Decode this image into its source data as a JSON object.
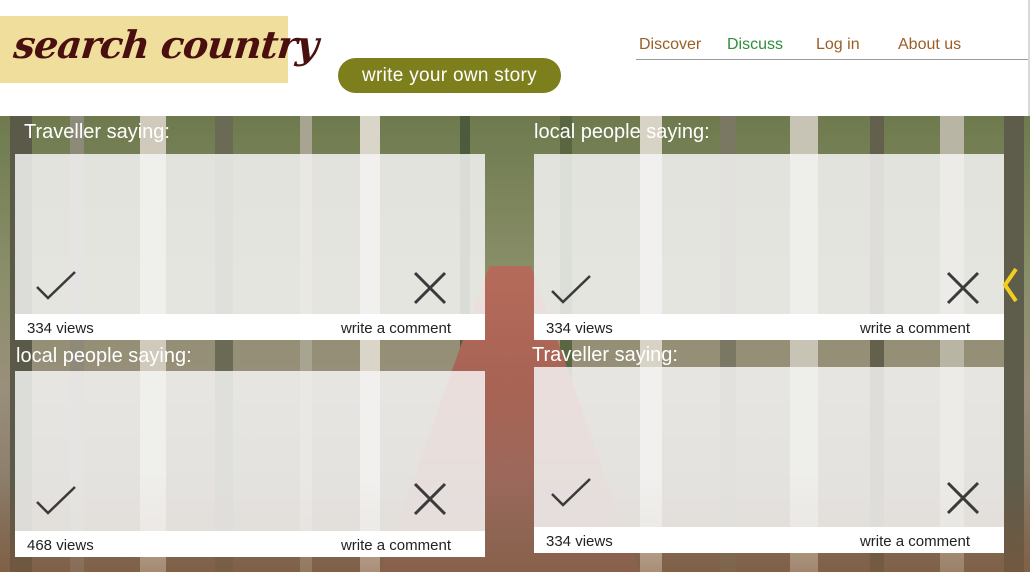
{
  "header": {
    "logo": "search country",
    "cta_label": "write your own story",
    "nav": [
      {
        "label": "Discover"
      },
      {
        "label": "Discuss",
        "active": true
      },
      {
        "label": "Log in"
      },
      {
        "label": "About us"
      }
    ]
  },
  "cards": [
    {
      "title": "Traveller saying:",
      "views": "334 views",
      "comment_label": "write a comment"
    },
    {
      "title": "local people saying:",
      "views": "334 views",
      "comment_label": "write a comment"
    },
    {
      "title": "local people saying:",
      "views": "468 views",
      "comment_label": "write a comment"
    },
    {
      "title": "Traveller saying:",
      "views": "334 views",
      "comment_label": "write a comment"
    }
  ],
  "icons": {
    "approve": "check-icon",
    "reject": "close-icon",
    "slider_prev": "chevron-left-icon"
  },
  "colors": {
    "logo_bg": "#f0df9c",
    "logo_text": "#4a0f0f",
    "cta_bg": "#7d7f1d",
    "nav_text": "#9a5e26",
    "nav_active": "#2f8e3d",
    "chevron": "#f2cf1f"
  }
}
